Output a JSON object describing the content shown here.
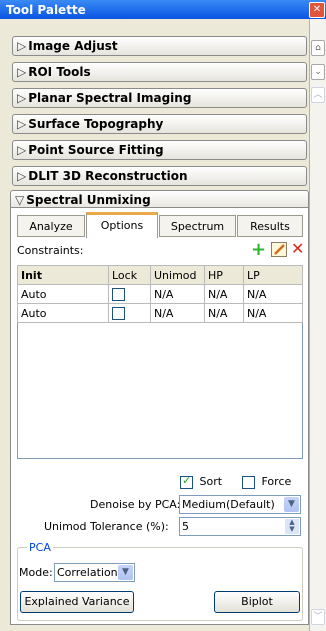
{
  "window": {
    "title": "Tool Palette",
    "close_glyph": "✕"
  },
  "sections": [
    {
      "label": "Image Adjust",
      "arrow": "▷"
    },
    {
      "label": "ROI Tools",
      "arrow": "▷"
    },
    {
      "label": "Planar Spectral Imaging",
      "arrow": "▷"
    },
    {
      "label": "Surface Topography",
      "arrow": "▷"
    },
    {
      "label": "Point Source Fitting",
      "arrow": "▷"
    },
    {
      "label": "DLIT 3D Reconstruction",
      "arrow": "▷"
    },
    {
      "label": "Spectral Unmixing",
      "arrow": "▽"
    }
  ],
  "tabs": [
    {
      "label": "Analyze",
      "active": false
    },
    {
      "label": "Options",
      "active": true
    },
    {
      "label": "Spectrum",
      "active": false
    },
    {
      "label": "Results",
      "active": false
    }
  ],
  "constraints": {
    "label": "Constraints:",
    "add_icon": "plus-icon",
    "edit_icon": "edit-icon",
    "delete_icon": "delete-icon",
    "add_color": "#2fb52f",
    "delete_color": "#d82a1e",
    "columns": [
      "Init",
      "Lock",
      "Unimod",
      "HP",
      "LP"
    ],
    "rows": [
      {
        "init": "Auto",
        "lock": false,
        "unimod": "N/A",
        "hp": "N/A",
        "lp": "N/A"
      },
      {
        "init": "Auto",
        "lock": false,
        "unimod": "N/A",
        "hp": "N/A",
        "lp": "N/A"
      }
    ]
  },
  "sort": {
    "label": "Sort",
    "checked": true
  },
  "force": {
    "label": "Force",
    "checked": false
  },
  "denoise": {
    "label": "Denoise by PCA:",
    "value": "Medium(Default)"
  },
  "unimod_tolerance": {
    "label": "Unimod Tolerance (%):",
    "value": "5"
  },
  "pca": {
    "legend": "PCA",
    "mode_label": "Mode:",
    "mode_value": "Correlation",
    "explained_variance_label": "Explained Variance",
    "biplot_label": "Biplot"
  },
  "colors": {
    "accent_tab": "#e8a84b",
    "titlebar": "#0a54e3"
  }
}
